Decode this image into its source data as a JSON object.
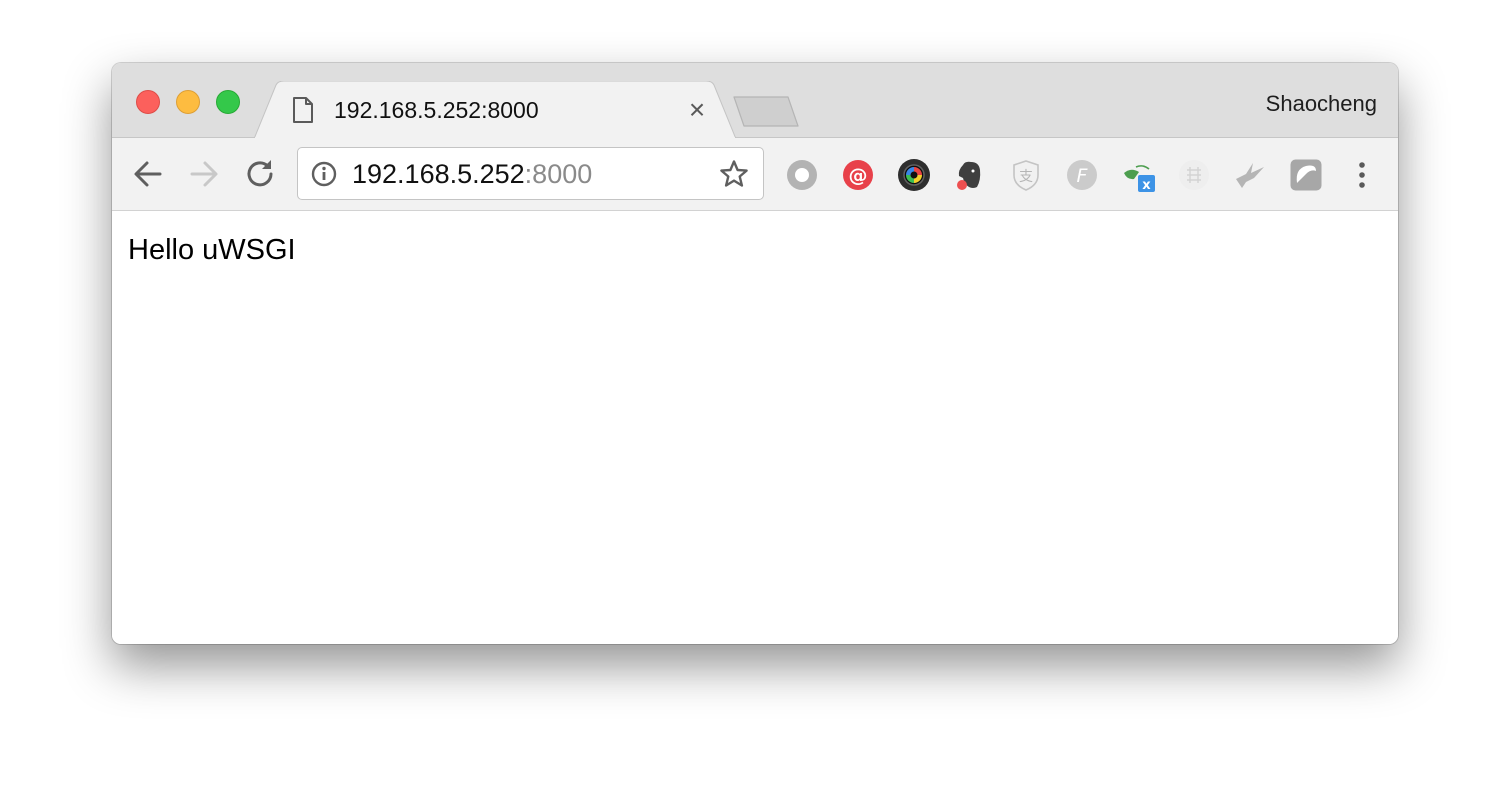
{
  "browser": {
    "profile_name": "Shaocheng",
    "tab": {
      "title": "192.168.5.252:8000",
      "close_glyph": "×"
    },
    "address_bar": {
      "host": "192.168.5.252",
      "port": ":8000"
    },
    "extensions": [
      "gray-circle-icon",
      "red-at-sign-icon",
      "camera-lens-icon",
      "evernote-elephant-icon",
      "alipay-shield-icon",
      "f-circle-icon",
      "translate-x-icon",
      "gray-seal-icon",
      "hummingbird-icon",
      "gray-square-icon"
    ]
  },
  "page": {
    "body_text": "Hello uWSGI"
  },
  "colors": {
    "close": "#fc605c",
    "minimize": "#fdbc40",
    "maximize": "#34c84a",
    "port_text": "#8a8a8a"
  }
}
